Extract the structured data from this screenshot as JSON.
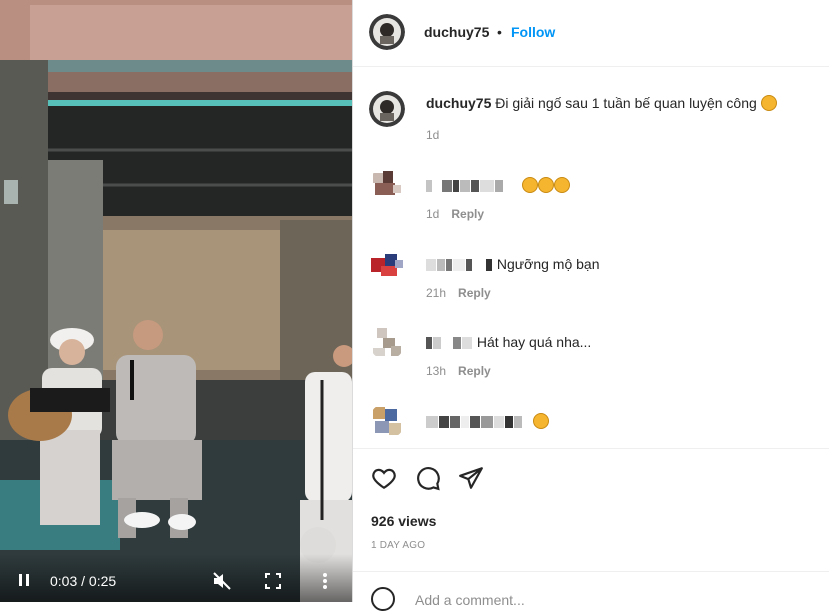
{
  "video": {
    "time_display": "0:03 / 0:25",
    "progress": 0.12
  },
  "post": {
    "author": "duchuy75",
    "separator": "•",
    "follow_label": "Follow",
    "caption_author": "duchuy75",
    "caption": "Đi giải ngố sau 1 tuần bế quan luyện công",
    "caption_age": "1d",
    "views": "926 views",
    "posted_ago": "1 DAY AGO"
  },
  "comments": [
    {
      "text": "",
      "age": "1d",
      "reply": "Reply",
      "emoji_count": 3
    },
    {
      "text": "Ngưỡng mộ bạn",
      "age": "21h",
      "reply": "Reply",
      "emoji_count": 0
    },
    {
      "text": "Hát hay quá nha...",
      "age": "13h",
      "reply": "Reply",
      "emoji_count": 0
    },
    {
      "text": "",
      "age": "",
      "reply": "",
      "emoji_count": 1
    }
  ],
  "comment_input": {
    "placeholder": "Add a comment..."
  },
  "icons": [
    "pause-icon",
    "mute-icon",
    "fullscreen-icon",
    "more-icon",
    "heart-icon",
    "comment-icon",
    "share-icon",
    "smiley-icon"
  ],
  "colors": {
    "link": "#0095f6",
    "muted": "#8e8e8e",
    "text": "#262626"
  }
}
